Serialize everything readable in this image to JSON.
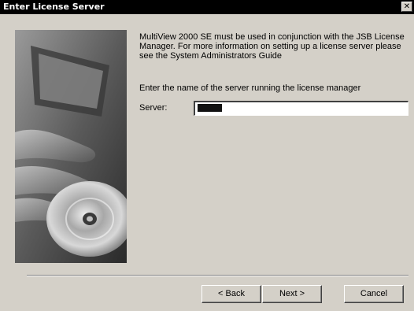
{
  "window": {
    "title": "Enter License Server",
    "close_glyph": "✕"
  },
  "content": {
    "message": "MultiView 2000 SE must be used in conjunction with the JSB License Manager. For more information on setting up a license server please see the System Administrators Guide",
    "prompt": "Enter the name of the server running the license manager"
  },
  "server": {
    "label": "Server:",
    "value": ""
  },
  "buttons": {
    "back": "< Back",
    "next": "Next >",
    "cancel": "Cancel"
  },
  "icons": {
    "close": "close-icon",
    "artwork": "cd-disc-hand-image"
  }
}
